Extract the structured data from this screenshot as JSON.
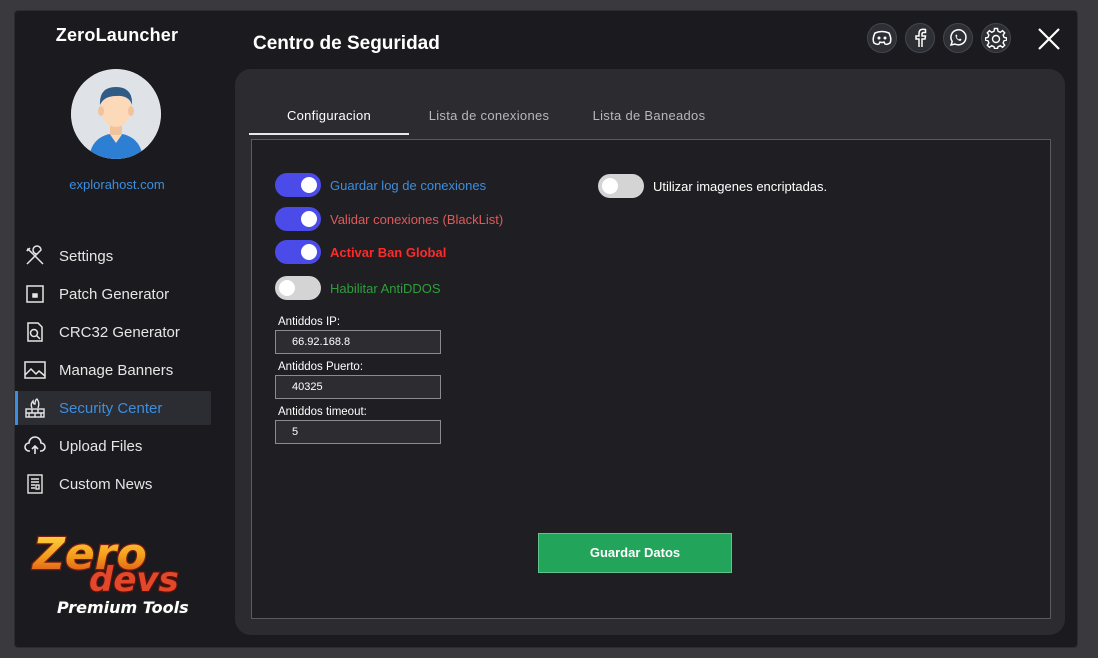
{
  "app": {
    "title": "ZeroLauncher",
    "host": "explorahost.com"
  },
  "sidebar": {
    "items": [
      {
        "label": "Settings",
        "icon": "tools-icon"
      },
      {
        "label": "Patch Generator",
        "icon": "patch-icon"
      },
      {
        "label": "CRC32 Generator",
        "icon": "file-search-icon"
      },
      {
        "label": "Manage Banners",
        "icon": "image-icon"
      },
      {
        "label": "Security Center",
        "icon": "firewall-icon",
        "active": true
      },
      {
        "label": "Upload Files",
        "icon": "cloud-upload-icon"
      },
      {
        "label": "Custom News",
        "icon": "news-icon"
      }
    ]
  },
  "logo": {
    "line1": "Zero",
    "line2": "devs",
    "line3": "Premium Tools"
  },
  "header": {
    "title": "Centro de Seguridad",
    "icons": [
      "discord-icon",
      "facebook-icon",
      "whatsapp-icon",
      "gear-icon",
      "close-icon"
    ]
  },
  "tabs": [
    {
      "label": "Configuracion",
      "active": true
    },
    {
      "label": "Lista de conexiones",
      "active": false
    },
    {
      "label": "Lista de Baneados",
      "active": false
    }
  ],
  "toggles": [
    {
      "label": "Guardar log de conexiones",
      "on": true,
      "color": "#3b8ee0"
    },
    {
      "label": "Validar conexiones (BlackList)",
      "on": true,
      "color": "#e05a5a"
    },
    {
      "label": "Activar Ban Global",
      "on": true,
      "color": "#ff2a2a"
    },
    {
      "label": "Habilitar AntiDDOS",
      "on": false,
      "color": "#2e9e3a"
    },
    {
      "label": "Utilizar imagenes encriptadas.",
      "on": false,
      "color": "#ffffff"
    }
  ],
  "fields": {
    "ip": {
      "label": "Antiddos IP:",
      "value": "66.92.168.8"
    },
    "port": {
      "label": "Antiddos Puerto:",
      "value": "40325"
    },
    "timeout": {
      "label": "Antiddos timeout:",
      "value": "5"
    }
  },
  "save_label": "Guardar Datos",
  "colors": {
    "accent": "#3b8ee0",
    "toggle_on": "#4b4bea",
    "save": "#22a45a",
    "background": "#1b1b1f",
    "panel": "#2b2b30"
  }
}
